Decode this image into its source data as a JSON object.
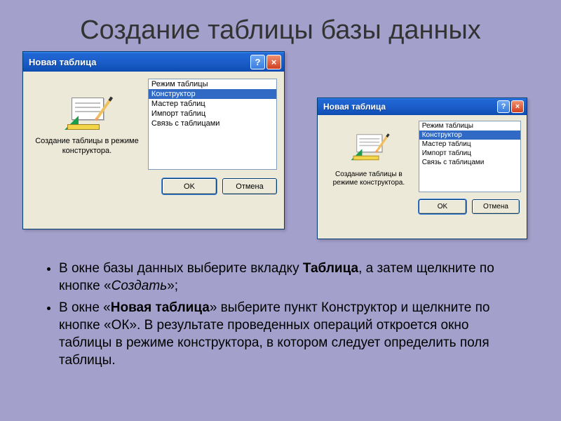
{
  "slide_title": "Создание таблицы базы данных",
  "dialog": {
    "title": "Новая таблица",
    "preview_caption": "Создание таблицы в режиме конструктора.",
    "list_items": [
      "Режим таблицы",
      "Конструктор",
      "Мастер таблиц",
      "Импорт таблиц",
      "Связь с таблицами"
    ],
    "selected_index": 1,
    "ok_label": "OK",
    "cancel_label": "Отмена"
  },
  "bullets": {
    "b1_pre": "В окне базы данных выберите вкладку ",
    "b1_bold": "Таблица",
    "b1_mid": ", а затем щелкните по кнопке «",
    "b1_italic": "Создать",
    "b1_post": "»;",
    "b2_pre": "В окне «",
    "b2_bold": "Новая таблица",
    "b2_post": "» выберите пункт Конструктор и щелкните по кнопке «ОК». В результате проведенных операций откроется окно таблицы в режиме конструктора, в котором следует определить поля таблицы."
  }
}
